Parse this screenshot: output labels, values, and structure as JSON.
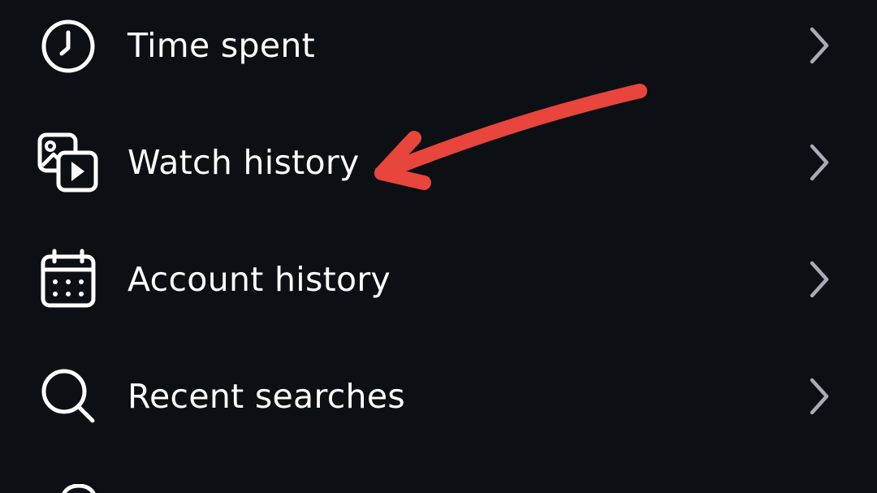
{
  "menu": {
    "items": [
      {
        "label": "Time spent",
        "icon": "clock-icon"
      },
      {
        "label": "Watch history",
        "icon": "media-history-icon"
      },
      {
        "label": "Account history",
        "icon": "calendar-icon"
      },
      {
        "label": "Recent searches",
        "icon": "search-icon"
      }
    ],
    "next_item_icon": "partially-visible-icon"
  },
  "annotation": {
    "type": "arrow",
    "color": "#e8453c",
    "points_to": "Watch history"
  },
  "colors": {
    "background": "#0c0f14",
    "text": "#ffffff",
    "chevron": "#a7adb6"
  }
}
